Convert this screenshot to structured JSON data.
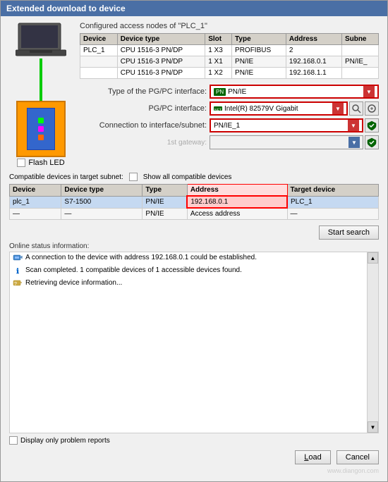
{
  "window": {
    "title": "Extended download to device"
  },
  "configured_table": {
    "title": "Configured access nodes of \"PLC_1\"",
    "columns": [
      "Device",
      "Device type",
      "Slot",
      "Type",
      "Address",
      "Subne"
    ],
    "rows": [
      {
        "device": "PLC_1",
        "device_type": "CPU 1516-3 PN/DP",
        "slot": "1 X3",
        "type": "PROFIBUS",
        "address": "2",
        "subnet": ""
      },
      {
        "device": "",
        "device_type": "CPU 1516-3 PN/DP",
        "slot": "1 X1",
        "type": "PN/IE",
        "address": "192.168.0.1",
        "subnet": "PN/IE_"
      },
      {
        "device": "",
        "device_type": "CPU 1516-3 PN/DP",
        "slot": "1 X2",
        "type": "PN/IE",
        "address": "192.168.1.1",
        "subnet": ""
      }
    ]
  },
  "interface": {
    "pg_pc_type_label": "Type of the PG/PC interface:",
    "pg_pc_label": "PG/PC interface:",
    "connection_label": "Connection to interface/subnet:",
    "gateway_label": "1st gateway:",
    "pg_pc_type_value": "PN/IE",
    "pg_pc_value": "Intel(R) 82579V Gigabit",
    "connection_value": "PN/IE_1",
    "gateway_value": ""
  },
  "compatible_table": {
    "header": "Compatible devices in target subnet:",
    "show_all_label": "Show all compatible devices",
    "columns": [
      "Device",
      "Device type",
      "Type",
      "Address",
      "Target device"
    ],
    "rows": [
      {
        "device": "plc_1",
        "device_type": "S7-1500",
        "type": "PN/IE",
        "address": "192.168.0.1",
        "target": "PLC_1",
        "highlighted": true
      },
      {
        "device": "—",
        "device_type": "—",
        "type": "PN/IE",
        "address": "Access address",
        "target": "—",
        "highlighted": false
      }
    ]
  },
  "flash_led": {
    "label": "Flash LED"
  },
  "buttons": {
    "start_search": "Start search",
    "load": "Load",
    "cancel": "Cancel"
  },
  "status": {
    "title": "Online status information:",
    "items": [
      {
        "icon": "connect",
        "text": "A connection to the device with address 192.168.0.1 could be established."
      },
      {
        "icon": "info",
        "text": "Scan completed. 1 compatible devices of 1 accessible devices found."
      },
      {
        "icon": "question",
        "text": "Retrieving device information..."
      }
    ],
    "display_only_problems": "Display only problem reports"
  },
  "watermark": "www.diangon.com"
}
